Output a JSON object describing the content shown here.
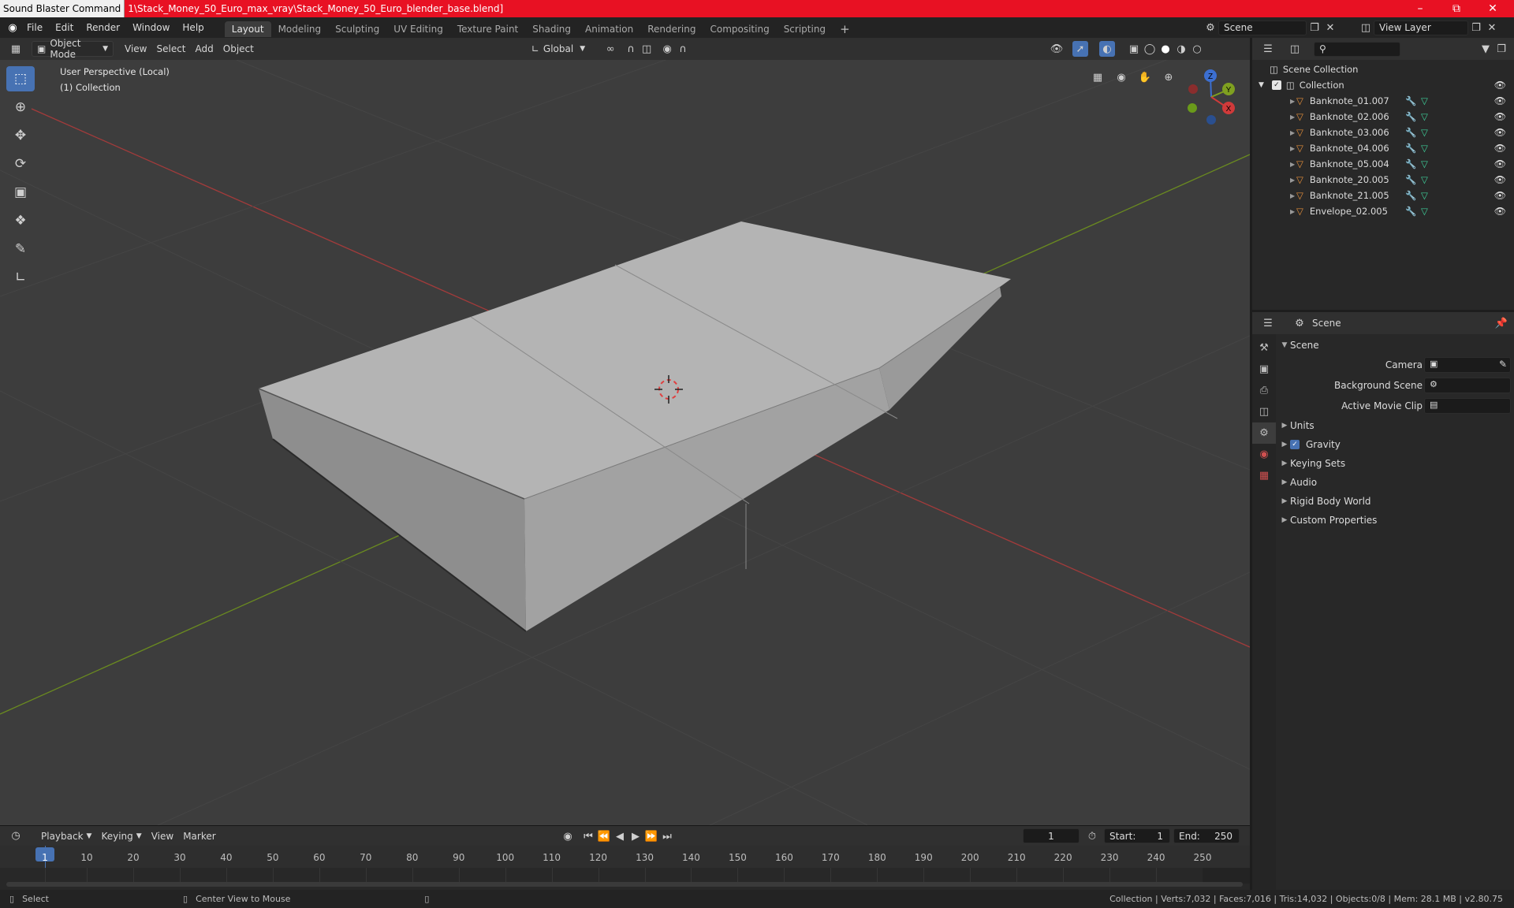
{
  "window": {
    "app_title": "Sound Blaster Command",
    "file_path": "1\\Stack_Money_50_Euro_max_vray\\Stack_Money_50_Euro_blender_base.blend]"
  },
  "menu": {
    "file": "File",
    "edit": "Edit",
    "render": "Render",
    "window": "Window",
    "help": "Help"
  },
  "workspaces": [
    "Layout",
    "Modeling",
    "Sculpting",
    "UV Editing",
    "Texture Paint",
    "Shading",
    "Animation",
    "Rendering",
    "Compositing",
    "Scripting"
  ],
  "scene_field": "Scene",
  "view_layer_field": "View Layer",
  "viewport": {
    "mode": "Object Mode",
    "view": "View",
    "select": "Select",
    "add": "Add",
    "object": "Object",
    "orientation": "Global",
    "overlay_line1": "User Perspective (Local)",
    "overlay_line2": "(1) Collection",
    "gizmo": {
      "x": "X",
      "y": "Y",
      "z": "Z"
    }
  },
  "outliner": {
    "root": "Scene Collection",
    "collection": "Collection",
    "objects": [
      "Banknote_01.007",
      "Banknote_02.006",
      "Banknote_03.006",
      "Banknote_04.006",
      "Banknote_05.004",
      "Banknote_20.005",
      "Banknote_21.005",
      "Envelope_02.005"
    ]
  },
  "properties": {
    "header": "Scene",
    "section": "Scene",
    "camera_label": "Camera",
    "background_label": "Background Scene",
    "movie_clip_label": "Active Movie Clip",
    "panels": [
      "Units",
      "Gravity",
      "Keying Sets",
      "Audio",
      "Rigid Body World",
      "Custom Properties"
    ]
  },
  "timeline": {
    "playback": "Playback",
    "keying": "Keying",
    "view": "View",
    "marker": "Marker",
    "current_frame": "1",
    "start_label": "Start:",
    "start": "1",
    "end_label": "End:",
    "end": "250",
    "ruler": [
      "1",
      "10",
      "20",
      "30",
      "40",
      "50",
      "60",
      "70",
      "80",
      "90",
      "100",
      "110",
      "120",
      "130",
      "140",
      "150",
      "160",
      "170",
      "180",
      "190",
      "200",
      "210",
      "220",
      "230",
      "240",
      "250"
    ]
  },
  "status": {
    "select": "Select",
    "center": "Center View to Mouse",
    "stats": "Collection | Verts:7,032 | Faces:7,016 | Tris:14,032 | Objects:0/8 | Mem: 28.1 MB | v2.80.75"
  },
  "colors": {
    "accent": "#4772b3",
    "titlebar": "#e81123",
    "x_axis": "#c0392b",
    "y_axis": "#7fa020",
    "mesh_icon": "#e8913a",
    "modifier_icon": "#5a9fe0",
    "data_icon": "#3ecf9a"
  }
}
